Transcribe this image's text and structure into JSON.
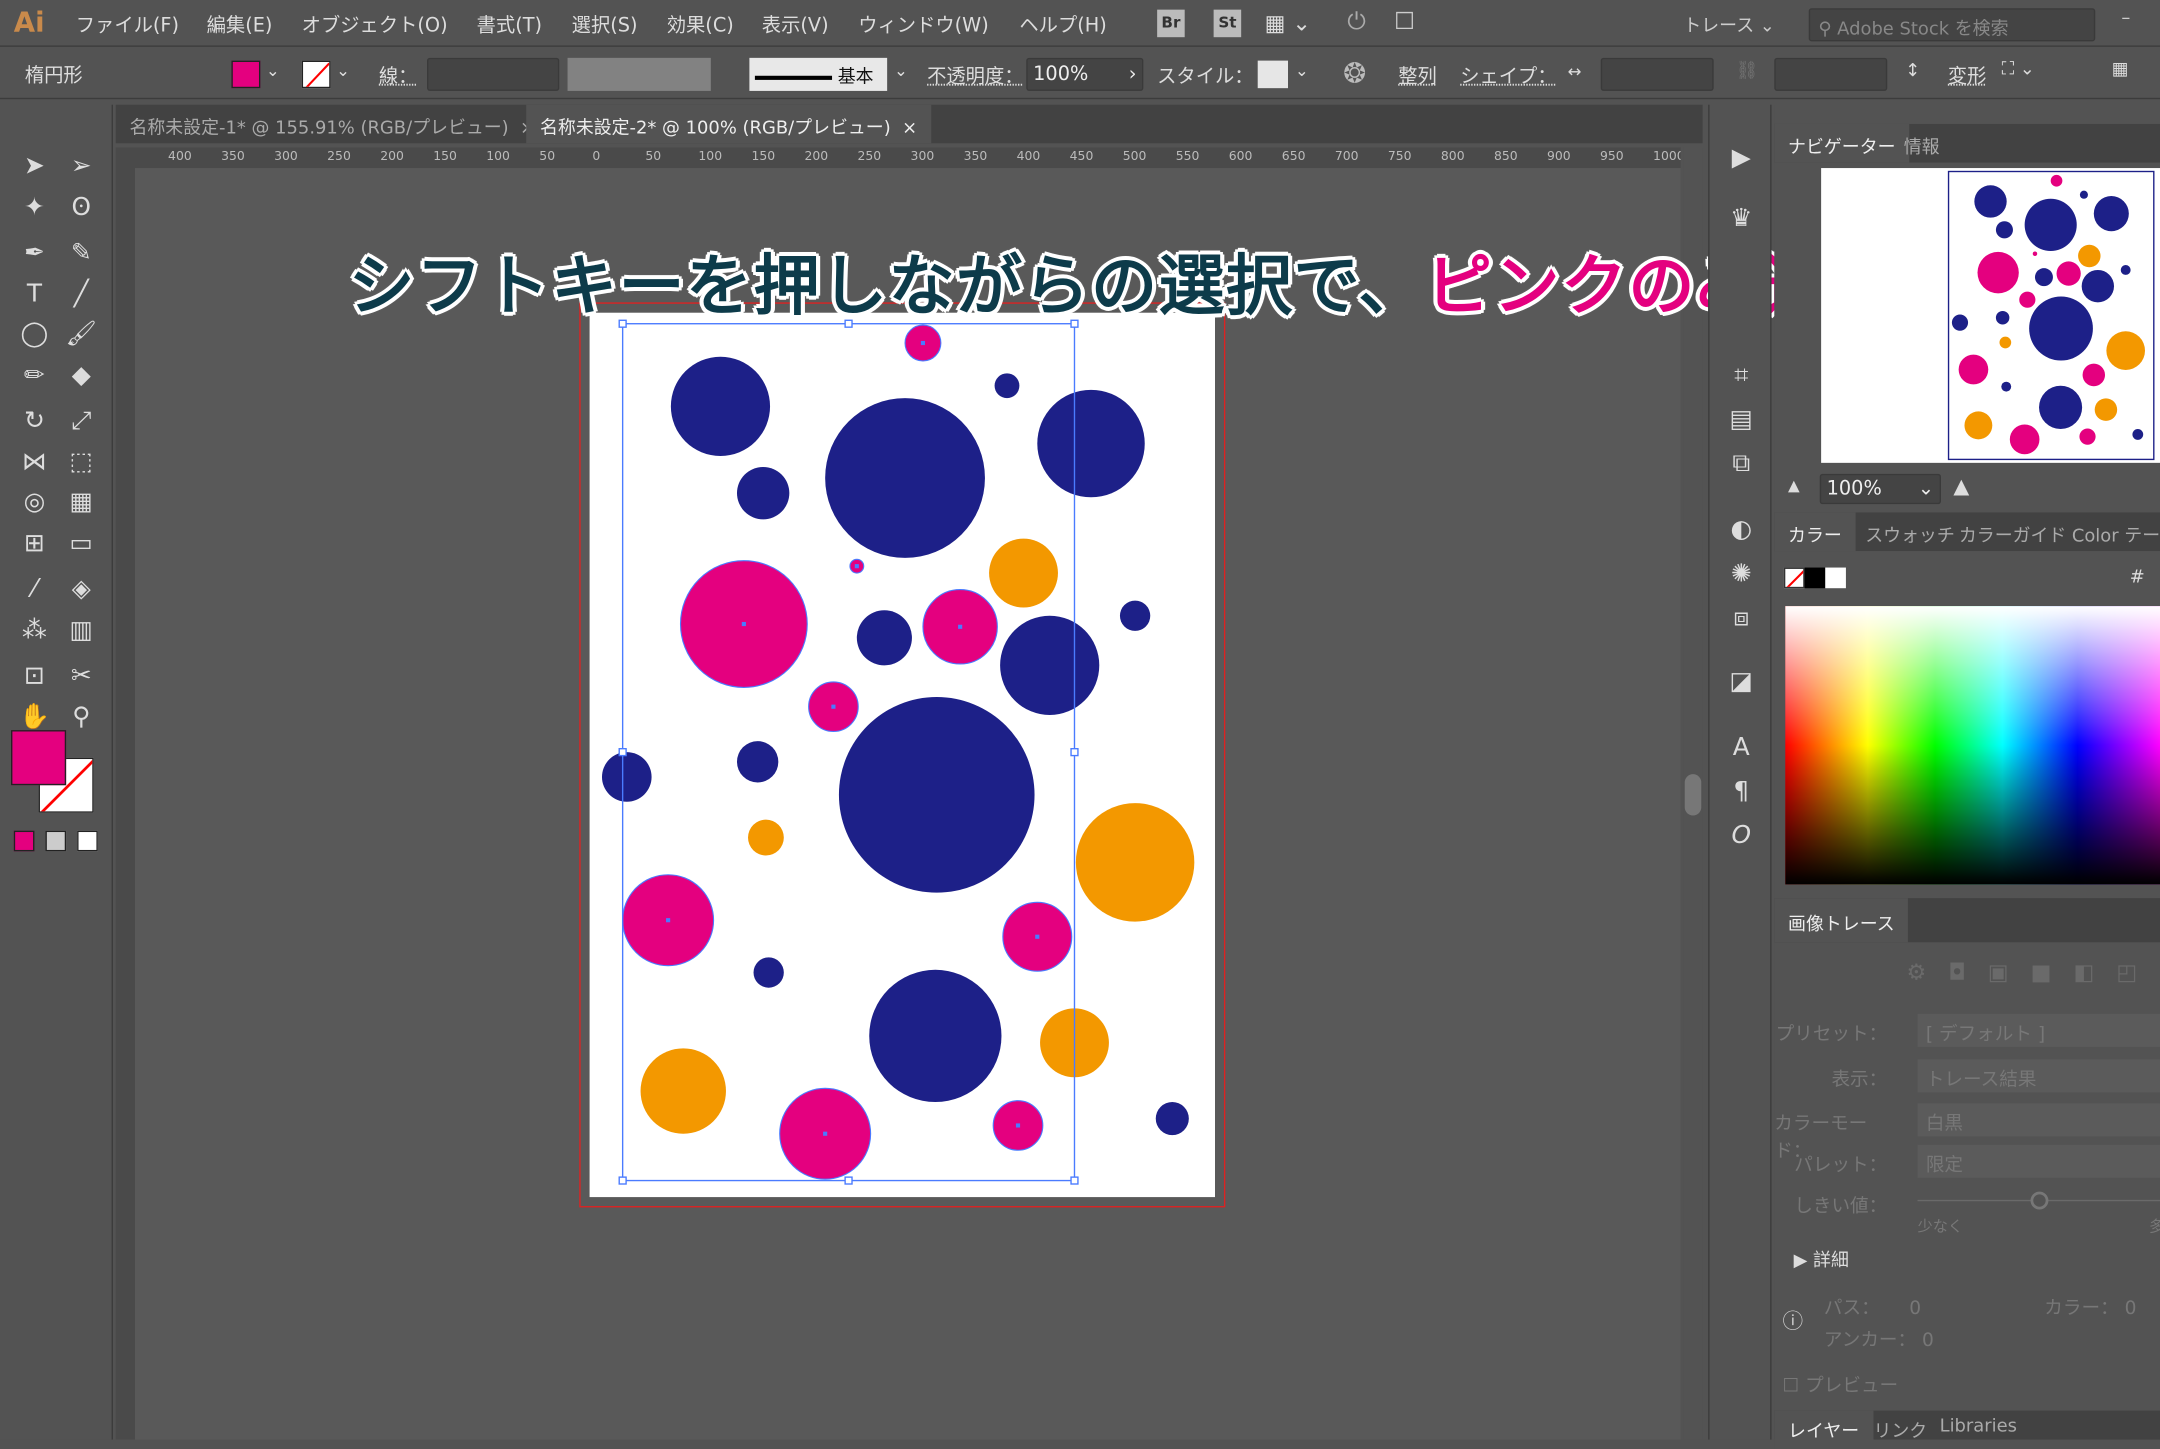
{
  "app": {
    "logo": "Ai"
  },
  "menu": [
    "ファイル(F)",
    "編集(E)",
    "オブジェクト(O)",
    "書式(T)",
    "選択(S)",
    "効果(C)",
    "表示(V)",
    "ウィンドウ(W)",
    "ヘルプ(H)"
  ],
  "menubar_right": {
    "br": "Br",
    "st": "St",
    "workspace": "トレース",
    "search_placeholder": "Adobe Stock を検索"
  },
  "control": {
    "object_type": "楕円形",
    "fill_color": "#e4007f",
    "stroke_label": "線：",
    "stroke_profile": "基本",
    "opacity_label": "不透明度：",
    "opacity_value": "100%",
    "style_label": "スタイル：",
    "align_label": "整列",
    "shape_label": "シェイプ：",
    "transform_label": "変形"
  },
  "tabs": [
    {
      "label": "名称未設定-1* @ 155.91% (RGB/プレビュー)",
      "close": "×"
    },
    {
      "label": "名称未設定-2* @ 100% (RGB/プレビュー)",
      "close": "×",
      "active": true
    }
  ],
  "ruler_labels": [
    "400",
    "350",
    "300",
    "250",
    "200",
    "150",
    "100",
    "50",
    "0",
    "50",
    "100",
    "150",
    "200",
    "250",
    "300",
    "350",
    "400",
    "450",
    "500",
    "550",
    "600",
    "650",
    "700",
    "750",
    "800",
    "850",
    "900",
    "950",
    "1000"
  ],
  "overlay_caption": {
    "part1": "シフトキーを押しながらの選択で、",
    "part2": "ピンクのみ選択",
    "color1": "#0d3b4a",
    "color2": "#e4007f"
  },
  "colors": {
    "pink": "#e4007f",
    "navy": "#1d2088",
    "orange": "#f39800",
    "selection": "#4a7bff"
  },
  "navigator": {
    "tabs": [
      "ナビゲーター",
      "情報"
    ],
    "zoom": "100%"
  },
  "color_panel": {
    "tabs": [
      "カラー",
      "スウォッチ",
      "カラーガイド",
      "Color テーマ"
    ],
    "hash": "#"
  },
  "image_trace": {
    "title": "画像トレース",
    "preset_label": "プリセット：",
    "preset_value": "[ デフォルト ]",
    "view_label": "表示：",
    "view_value": "トレース結果",
    "mode_label": "カラーモード：",
    "mode_value": "白黒",
    "palette_label": "パレット：",
    "palette_value": "限定",
    "threshold_label": "しきい値：",
    "threshold_min": "少なく",
    "threshold_max": "多",
    "threshold_level": 0.5,
    "advanced": "詳細",
    "paths_label": "パス：",
    "paths_value": "0",
    "colors_label": "カラー：",
    "colors_value": "0",
    "anchors_label": "アンカー：",
    "anchors_value": "0",
    "preview_label": "プレビュー"
  },
  "bottom_tabs": [
    "レイヤー",
    "リンク",
    "Libraries"
  ]
}
